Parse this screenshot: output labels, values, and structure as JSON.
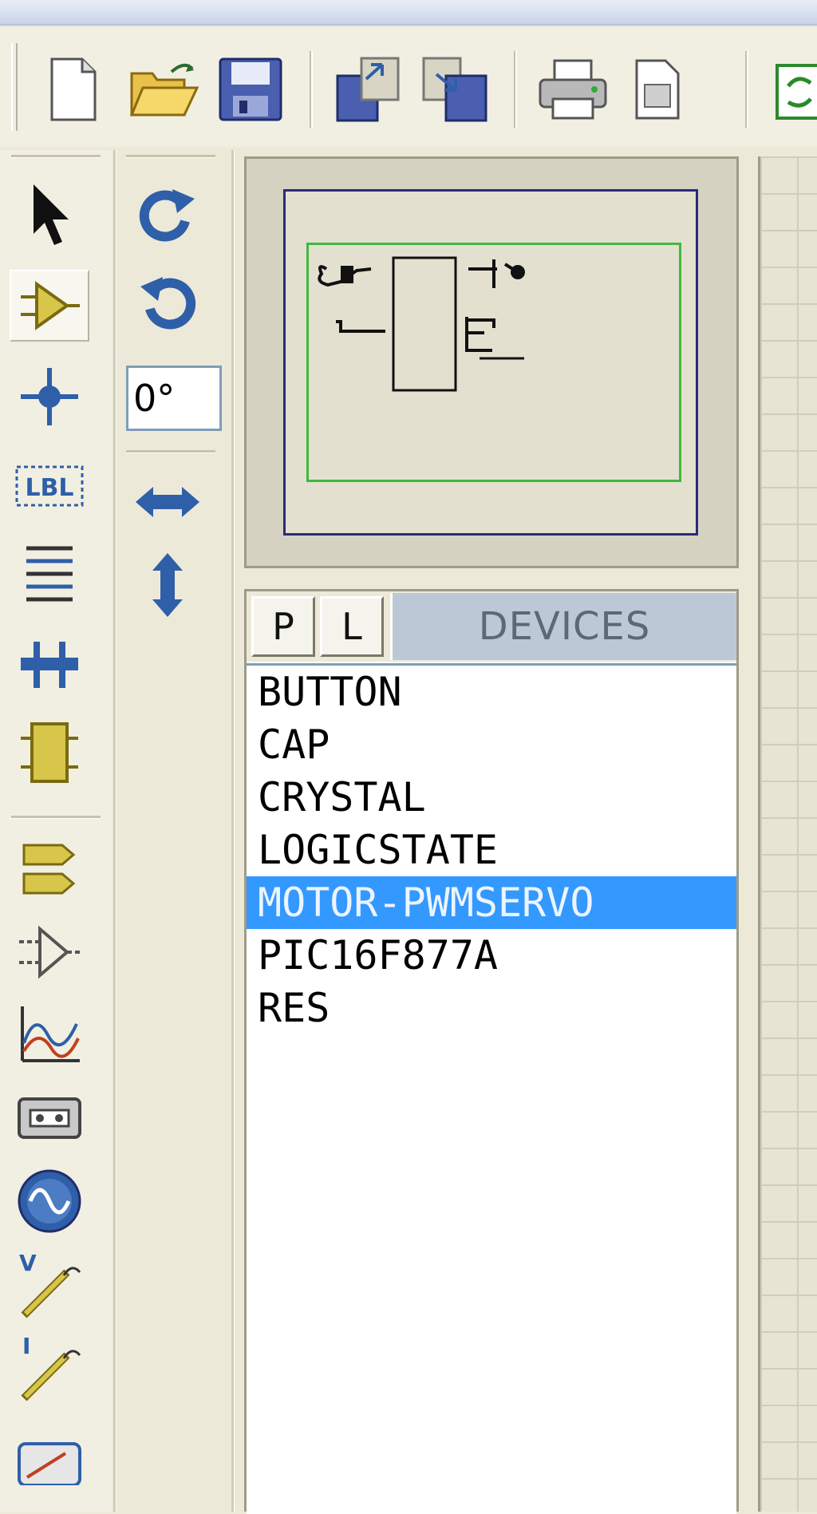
{
  "rotation": {
    "angle": "0°"
  },
  "devices": {
    "pick_button": "P",
    "library_button": "L",
    "title": "DEVICES",
    "items": [
      "BUTTON",
      "CAP",
      "CRYSTAL",
      "LOGICSTATE",
      "MOTOR-PWMSERVO",
      "PIC16F877A",
      "RES"
    ],
    "selected": "MOTOR-PWMSERVO"
  },
  "toolbar": {
    "buttons": [
      "new-file-icon",
      "open-folder-icon",
      "save-icon",
      "import-section-icon",
      "export-section-icon",
      "print-icon",
      "set-area-icon",
      "refresh-icon"
    ]
  },
  "tools": [
    "selection-arrow-icon",
    "component-mode-icon",
    "junction-dot-icon",
    "wire-label-icon",
    "text-script-icon",
    "bus-icon",
    "subcircuit-icon",
    "terminals-icon",
    "device-pins-icon",
    "graph-icon",
    "tape-recorder-icon",
    "generator-icon",
    "voltage-probe-icon",
    "current-probe-icon",
    "virtual-instruments-icon"
  ],
  "colors": {
    "selection": "#3399FF",
    "accent_blue": "#2E5FA8",
    "accent_yellow": "#D7C64A"
  }
}
